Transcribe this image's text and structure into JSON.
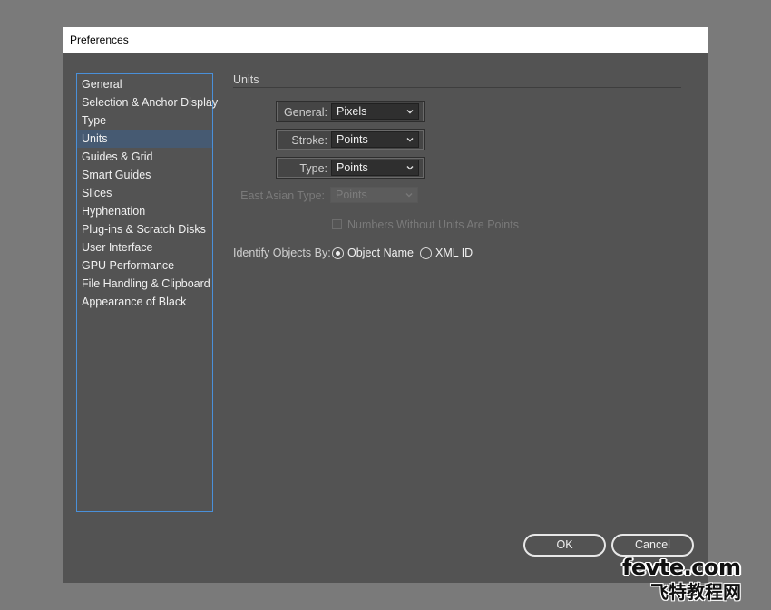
{
  "window": {
    "title": "Preferences"
  },
  "sidebar": {
    "items": [
      {
        "label": "General",
        "selected": false
      },
      {
        "label": "Selection & Anchor Display",
        "selected": false
      },
      {
        "label": "Type",
        "selected": false
      },
      {
        "label": "Units",
        "selected": true
      },
      {
        "label": "Guides & Grid",
        "selected": false
      },
      {
        "label": "Smart Guides",
        "selected": false
      },
      {
        "label": "Slices",
        "selected": false
      },
      {
        "label": "Hyphenation",
        "selected": false
      },
      {
        "label": "Plug-ins & Scratch Disks",
        "selected": false
      },
      {
        "label": "User Interface",
        "selected": false
      },
      {
        "label": "GPU Performance",
        "selected": false
      },
      {
        "label": "File Handling & Clipboard",
        "selected": false
      },
      {
        "label": "Appearance of Black",
        "selected": false
      }
    ]
  },
  "units": {
    "section_title": "Units",
    "general": {
      "label": "General:",
      "value": "Pixels"
    },
    "stroke": {
      "label": "Stroke:",
      "value": "Points"
    },
    "type": {
      "label": "Type:",
      "value": "Points"
    },
    "east_asian_type": {
      "label": "East Asian Type:",
      "value": "Points",
      "disabled": true
    },
    "numbers_without_units": {
      "label": "Numbers Without Units Are Points",
      "checked": false,
      "disabled": true
    },
    "identify_objects": {
      "label": "Identify Objects By:",
      "options": [
        {
          "label": "Object Name",
          "selected": true
        },
        {
          "label": "XML ID",
          "selected": false
        }
      ]
    }
  },
  "buttons": {
    "ok": "OK",
    "cancel": "Cancel"
  },
  "watermark": {
    "top": "fevte.com",
    "bottom": "飞特教程网"
  },
  "colors": {
    "dialog_bg": "#535353",
    "selection": "#465a72",
    "focus_border": "#4a90d9"
  }
}
